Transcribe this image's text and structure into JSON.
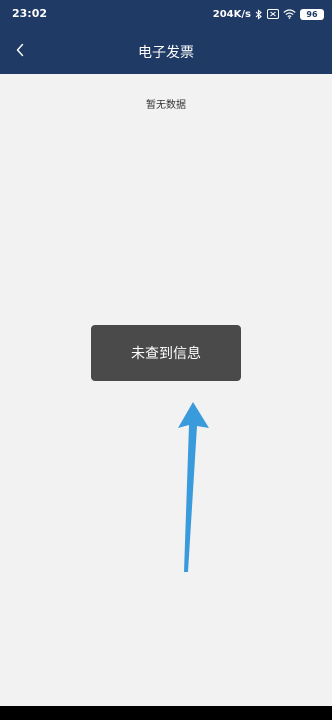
{
  "status_bar": {
    "time": "23:02",
    "network_speed": "204K/s",
    "battery": "96",
    "icons": [
      "bluetooth-icon",
      "sim-icon",
      "wifi-icon",
      "battery-icon"
    ]
  },
  "nav": {
    "back_icon": "back-chevron-icon",
    "title": "电子发票"
  },
  "content": {
    "empty_message": "暂无数据"
  },
  "toast": {
    "message": "未查到信息"
  },
  "annotation": {
    "icon": "arrow-up-icon",
    "color": "#3a9bdc"
  },
  "colors": {
    "header": "#1f3a64",
    "background": "#f2f2f2",
    "toast": "#4a4a4a"
  }
}
